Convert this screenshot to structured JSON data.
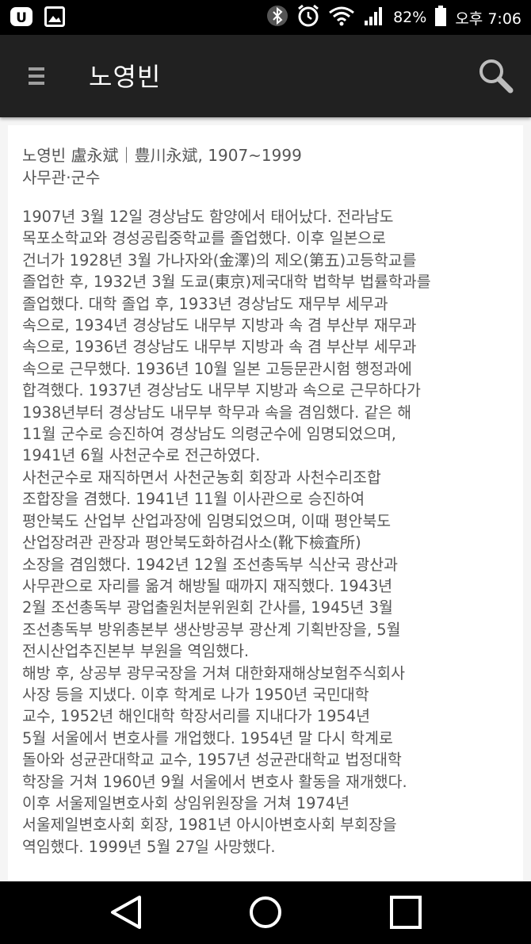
{
  "status_bar": {
    "battery": "82%",
    "time": "오후 7:06",
    "icons": [
      "u-plus-icon",
      "gallery-icon",
      "bluetooth-icon",
      "alarm-icon",
      "wifi-icon",
      "signal-icon",
      "battery-icon"
    ]
  },
  "app_bar": {
    "title": "노영빈",
    "icons": [
      "menu-icon",
      "search-icon"
    ]
  },
  "article": {
    "heading_line1": "노영빈 盧永斌｜豊川永斌, 1907~1999",
    "heading_line2": "사무관·군수",
    "lines": [
      "1907년 3월 12일 경상남도 함양에서 태어났다. 전라남도",
      "목포소학교와 경성공립중학교를 졸업했다. 이후 일본으로",
      "건너가 1928년 3월 가나자와(金澤)의 제오(第五)고등학교를",
      "졸업한 후, 1932년 3월 도쿄(東京)제국대학 법학부 법률학과를",
      "졸업했다. 대학 졸업 후, 1933년 경상남도 재무부 세무과",
      "속으로, 1934년 경상남도 내무부 지방과 속 겸 부산부 재무과",
      "속으로, 1936년 경상남도 내무부 지방과 속 겸 부산부 세무과",
      "속으로 근무했다. 1936년 10월 일본 고등문관시험 행정과에",
      "합격했다. 1937년 경상남도 내무부 지방과 속으로 근무하다가",
      "1938년부터 경상남도 내무부 학무과 속을 겸임했다. 같은 해",
      "11월 군수로 승진하여 경상남도 의령군수에 임명되었으며,",
      "1941년 6월 사천군수로 전근하였다.",
      "사천군수로 재직하면서 사천군농회 회장과 사천수리조합",
      "조합장을 겸했다. 1941년 11월 이사관으로 승진하여",
      "평안북도 산업부 산업과장에 임명되었으며, 이때 평안북도",
      "산업장려관 관장과 평안북도화하검사소(靴下檢査所)",
      "소장을 겸임했다. 1942년 12월 조선총독부 식산국 광산과",
      "사무관으로 자리를 옮겨 해방될 때까지 재직했다. 1943년",
      "2월 조선총독부 광업출원처분위원회 간사를, 1945년 3월",
      "조선총독부 방위총본부 생산방공부 광산계 기획반장을, 5월",
      "전시산업추진본부 부원을 역임했다.",
      "해방 후, 상공부 광무국장을 거쳐 대한화재해상보험주식회사",
      "사장 등을 지냈다. 이후 학계로 나가 1950년 국민대학",
      "교수, 1952년 해인대학 학장서리를 지내다가 1954년",
      "5월 서울에서 변호사를 개업했다. 1954년 말 다시 학계로",
      "돌아와 성균관대학교 교수, 1957년 성균관대학교 법정대학",
      "학장을 거쳐 1960년 9월 서울에서 변호사 활동을 재개했다.",
      "이후 서울제일변호사회 상임위원장을 거쳐 1974년",
      "서울제일변호사회 회장, 1981년 아시아변호사회 부회장을",
      "역임했다. 1999년 5월 27일 사망했다."
    ]
  },
  "nav_bar": {
    "icons": [
      "back-icon",
      "home-icon",
      "recents-icon"
    ]
  },
  "colors": {
    "status_bar": "#000000",
    "app_bar": "#212121",
    "page_background": "#f5f5f5",
    "card_background": "#ffffff",
    "text": "#555555"
  }
}
